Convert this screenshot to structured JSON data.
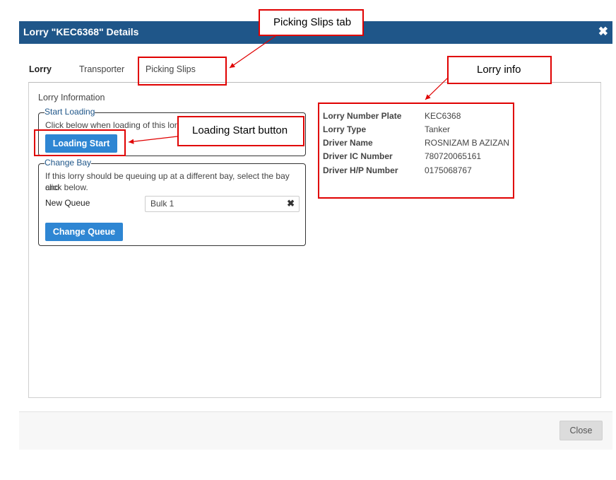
{
  "dialog": {
    "title": "Lorry \"KEC6368\" Details",
    "close_icon": "✖"
  },
  "tabs": [
    {
      "label": "Lorry",
      "active": true
    },
    {
      "label": "Transporter",
      "active": false
    },
    {
      "label": "Picking Slips",
      "active": false
    }
  ],
  "lorry_information": {
    "heading": "Lorry Information",
    "start_loading": {
      "legend": "Start Loading",
      "instruction": "Click below when loading of this lorry",
      "button_label": "Loading Start"
    },
    "change_bay": {
      "legend": "Change Bay",
      "instruction_line1": "If this lorry should be queuing up at a different bay, select the bay and",
      "instruction_line2": "click below.",
      "queue_label": "New Queue",
      "queue_value": "Bulk 1",
      "clear_icon": "✖",
      "button_label": "Change Queue"
    }
  },
  "lorry_details": [
    {
      "label": "Lorry Number Plate",
      "value": "KEC6368"
    },
    {
      "label": "Lorry Type",
      "value": "Tanker"
    },
    {
      "label": "Driver Name",
      "value": "ROSNIZAM B AZIZAN"
    },
    {
      "label": "Driver IC Number",
      "value": "780720065161"
    },
    {
      "label": "Driver H/P Number",
      "value": "0175068767"
    }
  ],
  "footer": {
    "close_label": "Close"
  },
  "annotations": {
    "picking_slips_tab": "Picking Slips tab",
    "lorry_info": "Lorry info",
    "loading_start_button": "Loading Start button"
  },
  "colors": {
    "title_bar": "#1f5689",
    "primary_button": "#2e86d3",
    "annotation": "#e00000"
  }
}
